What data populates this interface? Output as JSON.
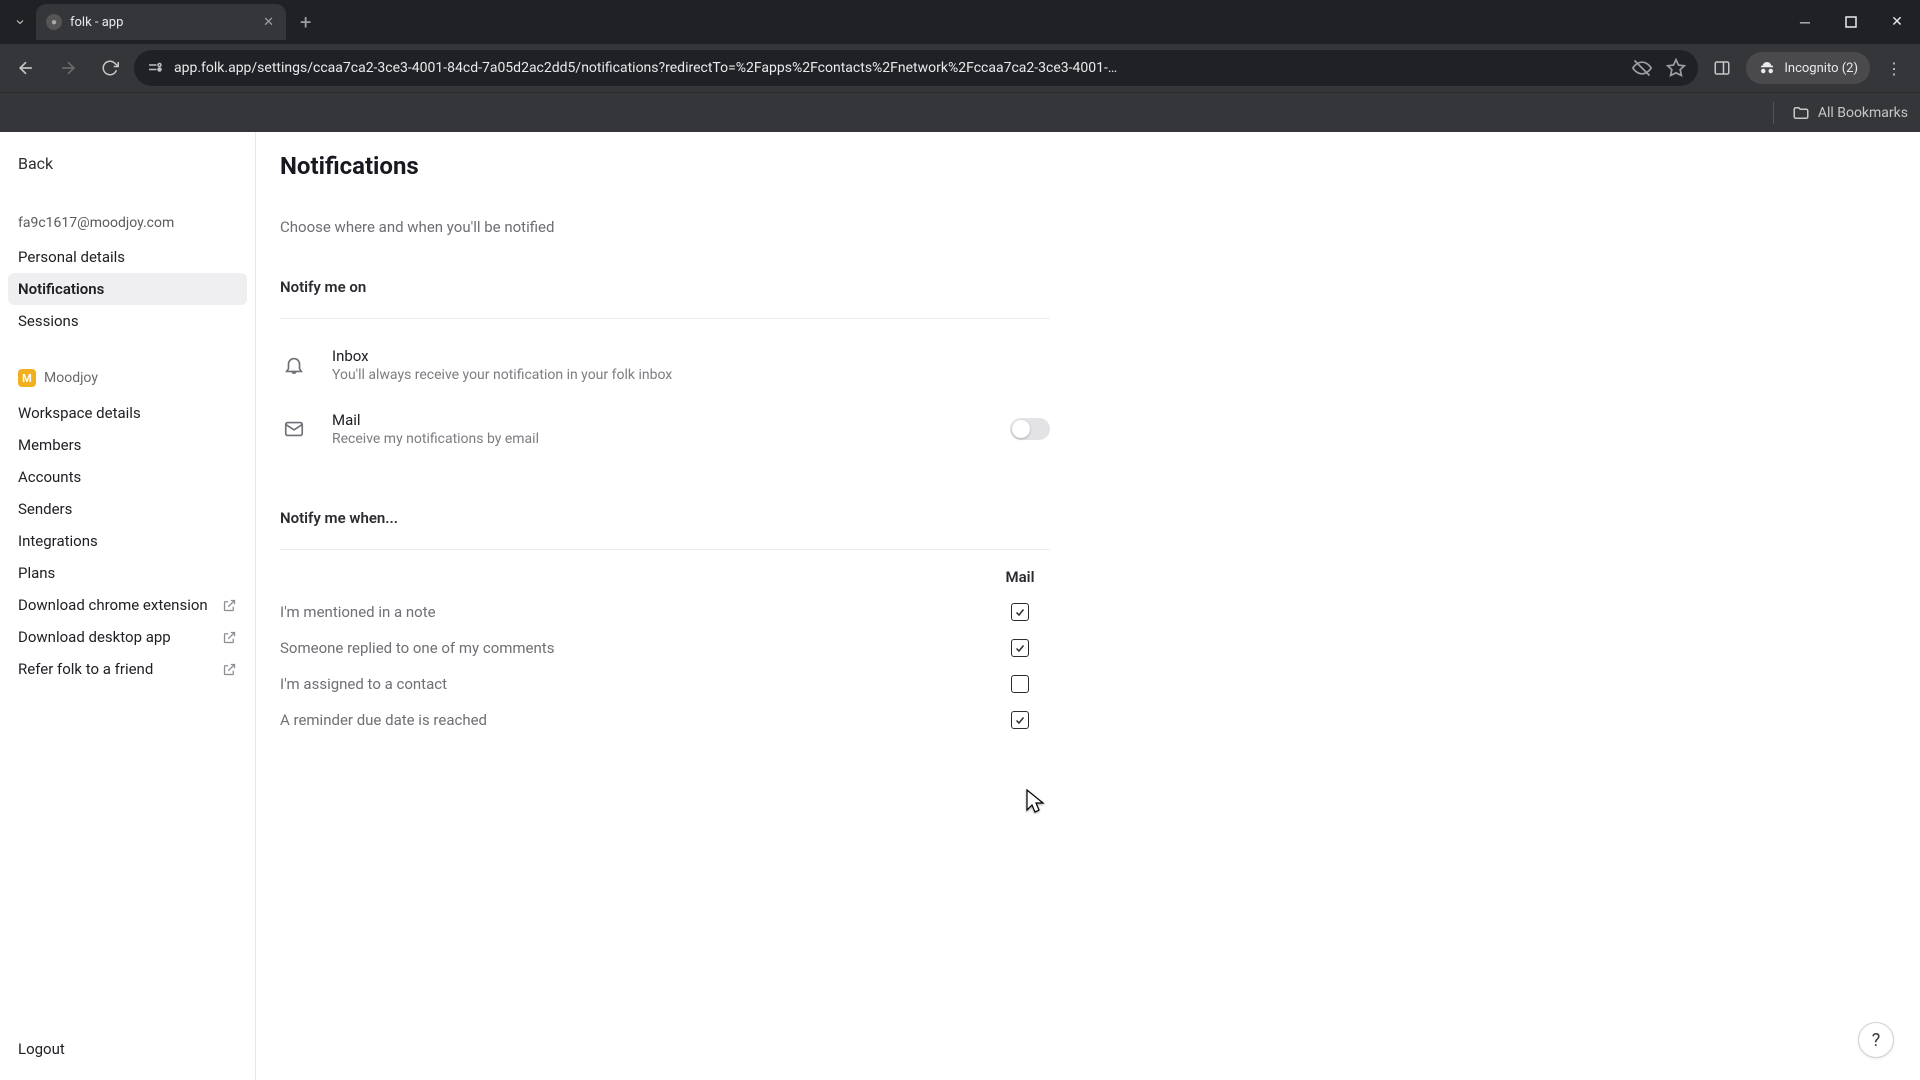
{
  "browser": {
    "tab_title": "folk - app",
    "url": "app.folk.app/settings/ccaa7ca2-3ce3-4001-84cd-7a05d2ac2dd5/notifications?redirectTo=%2Fapps%2Fcontacts%2Fnetwork%2Fccaa7ca2-3ce3-4001-…",
    "incognito_label": "Incognito (2)",
    "all_bookmarks": "All Bookmarks"
  },
  "sidebar": {
    "back": "Back",
    "email": "fa9c1617@moodjoy.com",
    "account_items": [
      {
        "label": "Personal details"
      },
      {
        "label": "Notifications",
        "active": true
      },
      {
        "label": "Sessions"
      }
    ],
    "workspace": {
      "badge": "M",
      "name": "Moodjoy"
    },
    "workspace_items": [
      {
        "label": "Workspace details"
      },
      {
        "label": "Members"
      },
      {
        "label": "Accounts"
      },
      {
        "label": "Senders"
      },
      {
        "label": "Integrations"
      },
      {
        "label": "Plans"
      },
      {
        "label": "Download chrome extension",
        "ext": true
      },
      {
        "label": "Download desktop app",
        "ext": true
      },
      {
        "label": "Refer folk to a friend",
        "ext": true
      }
    ],
    "logout": "Logout"
  },
  "page": {
    "title": "Notifications",
    "subtitle": "Choose where and when you'll be notified",
    "notify_on_heading": "Notify me on",
    "channels": {
      "inbox": {
        "title": "Inbox",
        "desc": "You'll always receive your notification in your folk inbox"
      },
      "mail": {
        "title": "Mail",
        "desc": "Receive my notifications by email",
        "enabled": false
      }
    },
    "notify_when_heading": "Notify me when...",
    "columns": {
      "mail": "Mail"
    },
    "rules": [
      {
        "label": "I'm mentioned in a note",
        "mail": true
      },
      {
        "label": "Someone replied to one of my comments",
        "mail": true
      },
      {
        "label": "I'm assigned to a contact",
        "mail": false
      },
      {
        "label": "A reminder due date is reached",
        "mail": true
      }
    ]
  },
  "help": "?"
}
